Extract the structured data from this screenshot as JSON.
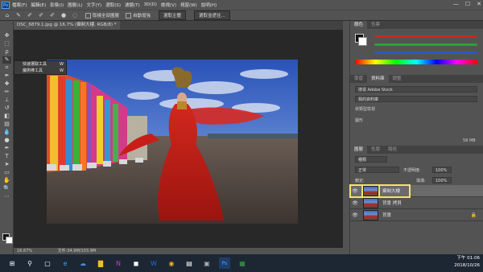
{
  "menu": {
    "logo": "Ps",
    "items": [
      "檔案(F)",
      "編輯(E)",
      "影像(I)",
      "圖層(L)",
      "文字(Y)",
      "選取(S)",
      "濾鏡(T)",
      "3D(D)",
      "檢視(V)",
      "視窗(W)",
      "說明(H)"
    ],
    "window_controls": [
      "—",
      "☐",
      "✕"
    ]
  },
  "options": {
    "check1": "取樣全部圖層",
    "check2": "自動增強",
    "btn1": "選取主體",
    "btn2": "選取並遮住..."
  },
  "document": {
    "tab_title": "DSC_6879.1.jpg @ 16.7% (攝制大樓, RGB/8) *",
    "zoom": "16.67%",
    "doc_info": "文件:34.9M/103.9M"
  },
  "popup": {
    "item1": "快速選取工具",
    "item1_key": "W",
    "item2": "魔術棒工具",
    "item2_key": "W"
  },
  "color_panel": {
    "tabs": [
      "顏色",
      "色票"
    ]
  },
  "library_panel": {
    "tabs": [
      "學習",
      "資料庫",
      "調整"
    ],
    "search_placeholder": "搜尋 Adobe Stock",
    "library_name": "我的資料庫",
    "sort_label": "依類型檢視",
    "section": "圖形",
    "size": "58 MB"
  },
  "layers_panel": {
    "tabs": [
      "圖層",
      "色版",
      "路徑"
    ],
    "kind": "種類",
    "blend_mode": "正常",
    "opacity_label": "不透明度:",
    "opacity_value": "100%",
    "lock_label": "鎖定:",
    "fill_label": "填滿:",
    "fill_value": "100%",
    "layers": [
      {
        "name": "攝制大樓"
      },
      {
        "name": "背景 拷貝"
      },
      {
        "name": "背景"
      }
    ]
  },
  "taskbar": {
    "time": "下午 01:06",
    "date": "2018/10/26"
  },
  "colors": {
    "accent_highlight": "#f0e36a",
    "ps_blue": "#4aa3ff",
    "slider_red": "#c62828",
    "slider_green": "#2e9e3a",
    "slider_blue": "#2f56c9"
  }
}
